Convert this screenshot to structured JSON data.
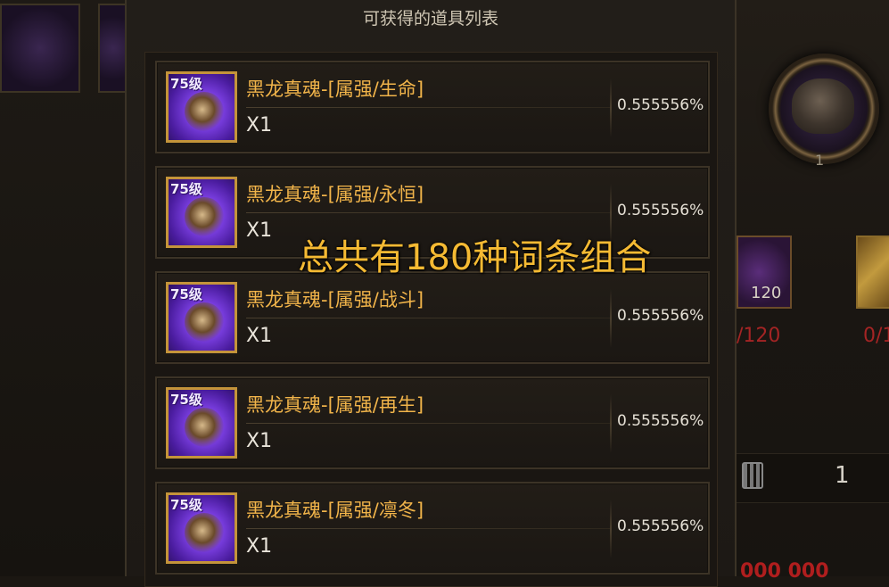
{
  "panel": {
    "title": "可获得的道具列表"
  },
  "items": [
    {
      "level": "75级",
      "name": "黑龙真魂-[属强/生命]",
      "quantity": "X1",
      "probability": "0.555556%"
    },
    {
      "level": "75级",
      "name": "黑龙真魂-[属强/永恒]",
      "quantity": "X1",
      "probability": "0.555556%"
    },
    {
      "level": "75级",
      "name": "黑龙真魂-[属强/战斗]",
      "quantity": "X1",
      "probability": "0.555556%"
    },
    {
      "level": "75级",
      "name": "黑龙真魂-[属强/再生]",
      "quantity": "X1",
      "probability": "0.555556%"
    },
    {
      "level": "75级",
      "name": "黑龙真魂-[属强/凛冬]",
      "quantity": "X1",
      "probability": "0.555556%"
    }
  ],
  "overlay_caption": "总共有180种词条组合",
  "background": {
    "orb_count": "1",
    "card_count": "120",
    "card_progress_1": "/120",
    "card_progress_2": "0/1",
    "calculator_value": "1",
    "red_amount": "000 000"
  },
  "colors": {
    "gold_text": "#f1b44a",
    "icon_border": "#c4943a",
    "overlay": "#f5ba33"
  }
}
